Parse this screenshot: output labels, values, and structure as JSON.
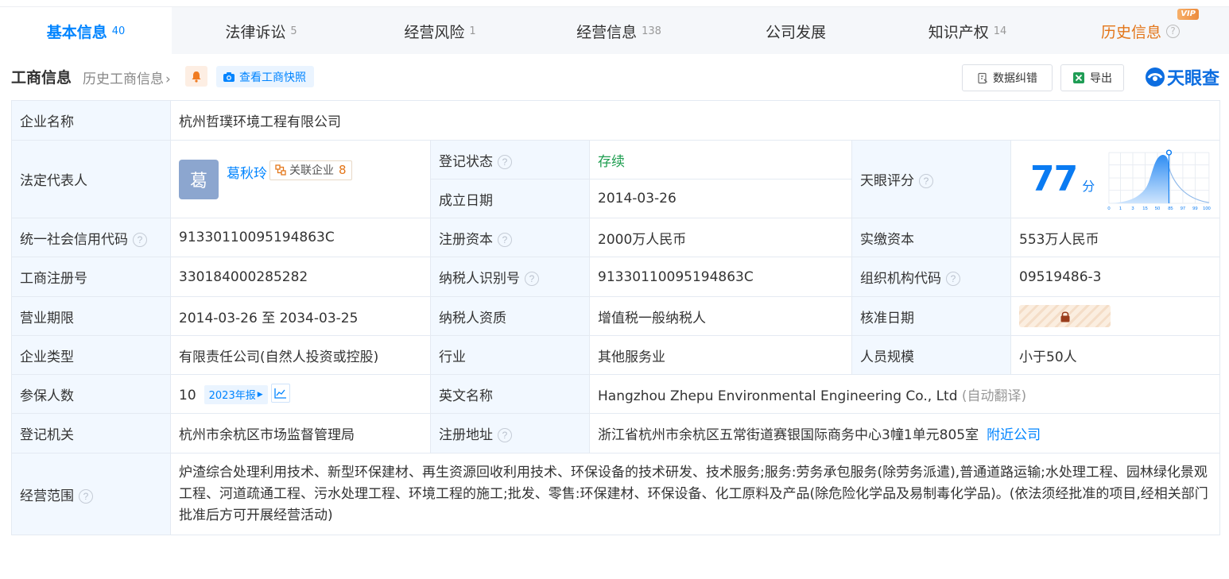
{
  "tabs": [
    {
      "label": "基本信息",
      "count": "40"
    },
    {
      "label": "法律诉讼",
      "count": "5"
    },
    {
      "label": "经营风险",
      "count": "1"
    },
    {
      "label": "经营信息",
      "count": "138"
    },
    {
      "label": "公司发展",
      "count": ""
    },
    {
      "label": "知识产权",
      "count": "14"
    },
    {
      "label": "历史信息",
      "badge": "VIP"
    }
  ],
  "toolbar": {
    "title": "工商信息",
    "history_link": "历史工商信息",
    "snapshot_label": "查看工商快照",
    "correction_label": "数据纠错",
    "export_label": "导出",
    "logo_text": "天眼查"
  },
  "info": {
    "company_name_label": "企业名称",
    "company_name": "杭州哲璞环境工程有限公司",
    "legal_rep_label": "法定代表人",
    "legal_rep_avatar": "葛",
    "legal_rep_name": "葛秋玲",
    "related_label": "关联企业",
    "related_count": "8",
    "reg_status_label": "登记状态",
    "reg_status": "存续",
    "founded_label": "成立日期",
    "founded": "2014-03-26",
    "score_label": "天眼评分",
    "score": "77",
    "score_unit": "分",
    "score_axis": [
      "0",
      "1",
      "3",
      "15",
      "50",
      "85",
      "97",
      "99",
      "100"
    ],
    "credit_code_label": "统一社会信用代码",
    "credit_code": "91330110095194863C",
    "reg_capital_label": "注册资本",
    "reg_capital": "2000万人民币",
    "paid_capital_label": "实缴资本",
    "paid_capital": "553万人民币",
    "biz_reg_no_label": "工商注册号",
    "biz_reg_no": "330184000285282",
    "taxpayer_id_label": "纳税人识别号",
    "taxpayer_id": "91330110095194863C",
    "org_code_label": "组织机构代码",
    "org_code": "09519486-3",
    "term_label": "营业期限",
    "term": "2014-03-26 至 2034-03-25",
    "taxpayer_qual_label": "纳税人资质",
    "taxpayer_qual": "增值税一般纳税人",
    "approval_date_label": "核准日期",
    "type_label": "企业类型",
    "type": "有限责任公司(自然人投资或控股)",
    "industry_label": "行业",
    "industry": "其他服务业",
    "staff_label": "人员规模",
    "staff": "小于50人",
    "insured_label": "参保人数",
    "insured": "10",
    "insured_year": "2023年报",
    "english_name_label": "英文名称",
    "english_name": "Hangzhou Zhepu Environmental Engineering Co., Ltd",
    "english_note": "(自动翻译)",
    "authority_label": "登记机关",
    "authority": "杭州市余杭区市场监督管理局",
    "address_label": "注册地址",
    "address": "浙江省杭州市余杭区五常街道赛银国际商务中心3幢1单元805室",
    "nearby_label": "附近公司",
    "scope_label": "经营范围",
    "scope": "炉渣综合处理利用技术、新型环保建材、再生资源回收利用技术、环保设备的技术研发、技术服务;服务:劳务承包服务(除劳务派遣),普通道路运输;水处理工程、园林绿化景观工程、河道疏通工程、污水处理工程、环境工程的施工;批发、零售:环保建材、环保设备、化工原料及产品(除危险化学品及易制毒化学品)。(依法须经批准的项目,经相关部门批准后方可开展经营活动)"
  }
}
